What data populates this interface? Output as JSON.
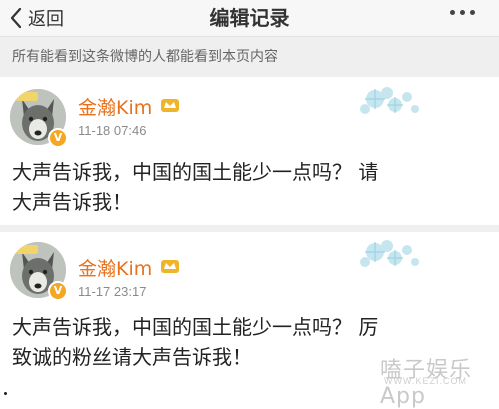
{
  "nav": {
    "back_label": "返回",
    "title": "编辑记录"
  },
  "notice": "所有能看到这条微博的人都能看到本页内容",
  "records": [
    {
      "username": "金瀚Kim",
      "time": "11-18 07:46",
      "text_line1": "大声告诉我，中国的国土能少一点吗？  请",
      "text_line2": "大声告诉我！"
    },
    {
      "username": "金瀚Kim",
      "time": "11-17 23:17",
      "text_line1": "大声告诉我，中国的国土能少一点吗？  厉",
      "text_line2": "致诚的粉丝请大声告诉我！"
    }
  ],
  "watermark": {
    "main": "嗑子娱乐App",
    "sub": "WWW.KEZI.COM"
  },
  "colors": {
    "username": "#e8721c",
    "vbadge": "#f5a623"
  },
  "icons": [
    "chevron-left-icon",
    "more-dots-icon",
    "verified-badge-icon",
    "vip-crown-icon",
    "snowflake-decoration-icon"
  ]
}
